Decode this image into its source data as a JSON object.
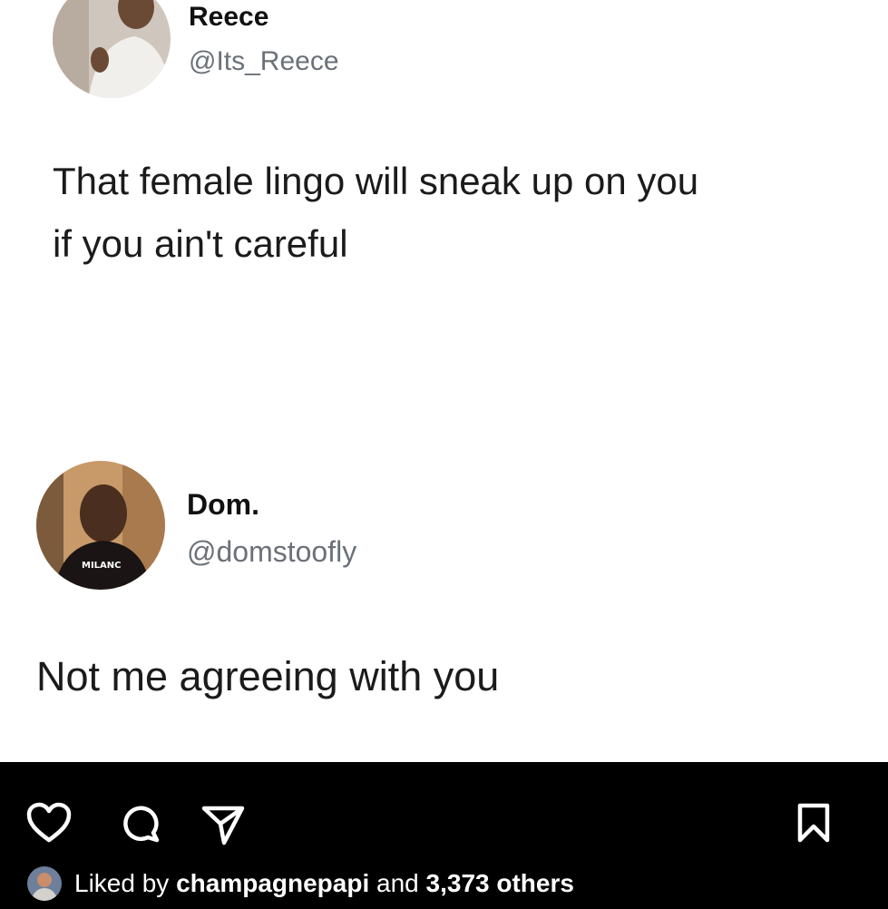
{
  "tweets": [
    {
      "name": "Reece",
      "handle": "@Its_Reece",
      "text_line1": "That female lingo will sneak up on you",
      "text_line2": "if you ain't careful"
    },
    {
      "name": "Dom.",
      "handle": "@domstoofly",
      "text": "Not me agreeing with you",
      "avatar_shirt_text": "MILANC"
    }
  ],
  "instagram": {
    "icons": [
      "heart-icon",
      "comment-icon",
      "share-icon",
      "bookmark-icon"
    ],
    "liked_prefix": "Liked by",
    "liked_user": "champagnepapi",
    "liked_and": "and",
    "liked_count": "3,373 others"
  },
  "colors": {
    "background": "#ffffff",
    "ig_bar": "#000000",
    "name": "#111111",
    "handle": "#6b7178",
    "text": "#1b1b1b"
  }
}
